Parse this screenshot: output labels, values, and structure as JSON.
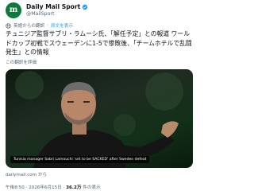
{
  "author": {
    "avatar_letter": "m",
    "display_name": "Daily Mail Sport",
    "handle": "@MailSport",
    "brand_color": "#0b7a3a",
    "verified_color": "#1d9bf0"
  },
  "translation": {
    "label": "英語からの翻訳",
    "separator": "·",
    "action": "原文を表示"
  },
  "tweet": {
    "text": "チュニジア監督サブリ・ラムーシ氏、「解任予定」との報道 ワールドカップ初戦でスウェーデンに1-5で惨敗後、「チームホテルで乱闘発生」との情報"
  },
  "rate_translation": "この翻訳を評価",
  "media": {
    "caption": "Tunisia manager Sabri Lamouchi 'set to be SACKED' after Sweden defeat"
  },
  "link": {
    "source": "dailymail.com から"
  },
  "meta": {
    "time": "午後8:50 · 2026年6月15日 · ",
    "views_count": "36.2万",
    "views_label": " 件の表示"
  }
}
